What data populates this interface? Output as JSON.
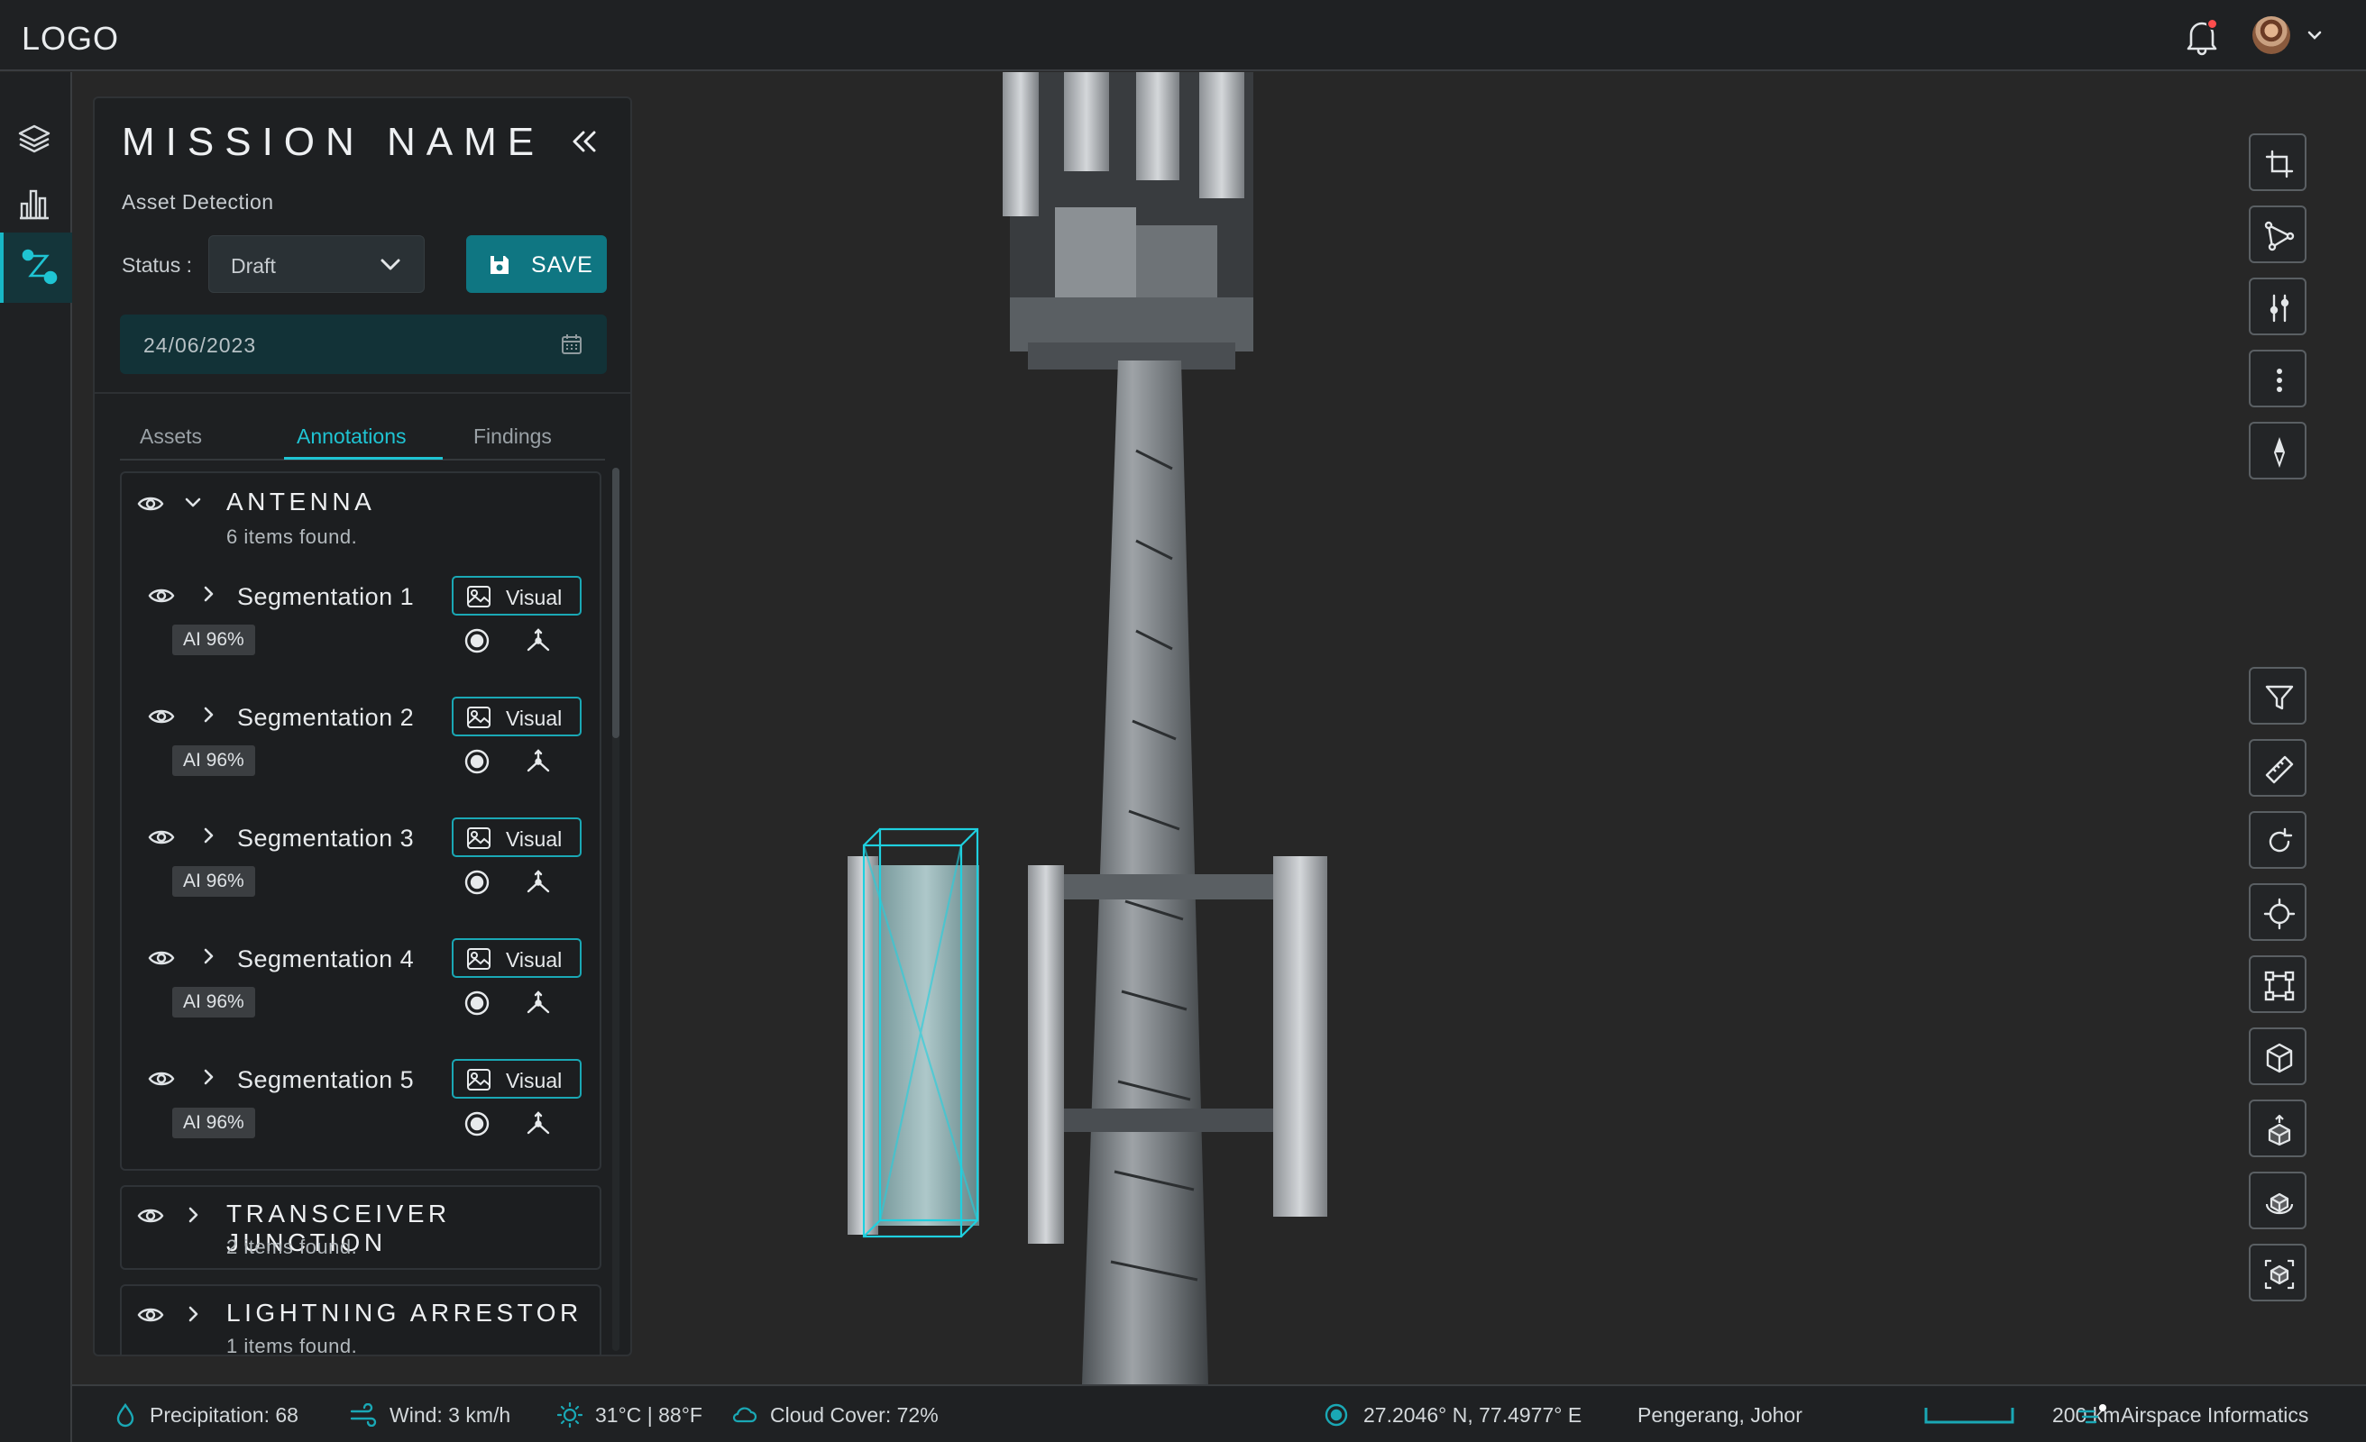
{
  "header": {
    "logo": "LOGO",
    "notification_icon": "bell-icon",
    "notification_dot_color": "#ff4d4d",
    "avatar_icon": "user-avatar"
  },
  "rail": {
    "items": [
      {
        "icon": "layers-icon",
        "active": false
      },
      {
        "icon": "bar-chart-icon",
        "active": false
      },
      {
        "icon": "route-icon",
        "active": true
      }
    ]
  },
  "panel": {
    "title": "MISSION NAME",
    "subtitle": "Asset Detection",
    "status_label": "Status :",
    "status_value": "Draft",
    "save_label": "SAVE",
    "date_value": "24/06/2023",
    "tabs": [
      {
        "label": "Assets",
        "active": false
      },
      {
        "label": "Annotations",
        "active": true
      },
      {
        "label": "Findings",
        "active": false
      }
    ],
    "groups": [
      {
        "title": "ANTENNA",
        "count": "6 items found.",
        "expanded": true,
        "items": [
          {
            "name": "Segmentation 1",
            "visual": "Visual",
            "ai": "AI 96%"
          },
          {
            "name": "Segmentation 2",
            "visual": "Visual",
            "ai": "AI 96%"
          },
          {
            "name": "Segmentation 3",
            "visual": "Visual",
            "ai": "AI 96%"
          },
          {
            "name": "Segmentation 4",
            "visual": "Visual",
            "ai": "AI 96%"
          },
          {
            "name": "Segmentation 5",
            "visual": "Visual",
            "ai": "AI 96%"
          }
        ]
      },
      {
        "title": "TRANSCEIVER JUNCTION",
        "count": "2 items found.",
        "expanded": false
      },
      {
        "title": "LIGHTNING ARRESTOR",
        "count": "1 items found.",
        "expanded": false
      }
    ]
  },
  "viewport": {
    "tools_top": [
      "crop-icon",
      "polygon-select-icon",
      "sliders-icon",
      "more-vertical-icon",
      "compass-icon"
    ],
    "tools_bottom": [
      "filter-icon",
      "ruler-icon",
      "rotate-icon",
      "crosshair-icon",
      "bounding-box-icon",
      "cube-icon",
      "cube-upload-icon",
      "cube-rotate-icon",
      "cube-focus-icon"
    ],
    "accent_color": "#1fd0df"
  },
  "footer": {
    "precipitation": "Precipitation: 68",
    "wind": "Wind: 3 km/h",
    "temperature": "31°C | 88°F",
    "cloud": "Cloud Cover: 72%",
    "coords": "27.2046° N, 77.4977° E",
    "location": "Pengerang, Johor",
    "scale": "200 km",
    "airspace": "Airspace Informatics"
  }
}
